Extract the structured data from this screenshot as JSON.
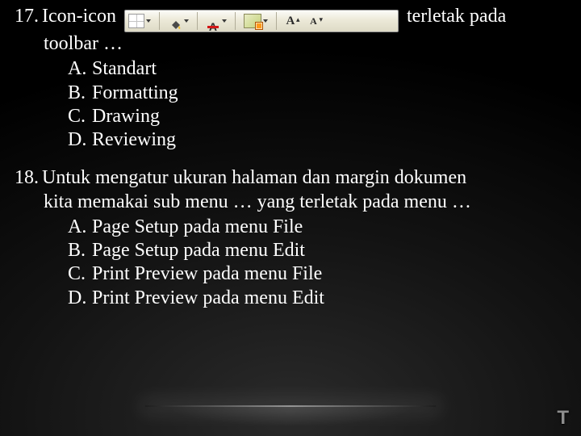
{
  "q17": {
    "number": "17.",
    "text_before_icons": "Icon-icon",
    "text_after_icons": "terletak pada",
    "line2": "toolbar …",
    "options": {
      "A": {
        "label": "A.",
        "text": "Standart"
      },
      "B": {
        "label": "B.",
        "text": "Formatting"
      },
      "C": {
        "label": "C.",
        "text": "Drawing"
      },
      "D": {
        "label": "D.",
        "text": "Reviewing"
      }
    }
  },
  "q18": {
    "number": "18.",
    "line1": "Untuk mengatur ukuran halaman dan margin dokumen",
    "line2": "kita memakai sub menu … yang terletak pada menu …",
    "options": {
      "A": {
        "label": "A.",
        "text": "Page Setup pada menu File"
      },
      "B": {
        "label": "B.",
        "text": "Page Setup pada menu Edit"
      },
      "C": {
        "label": "C.",
        "text": "Print Preview pada menu File"
      },
      "D": {
        "label": "D.",
        "text": "Print Preview pada menu Edit"
      }
    }
  },
  "corner": "T"
}
